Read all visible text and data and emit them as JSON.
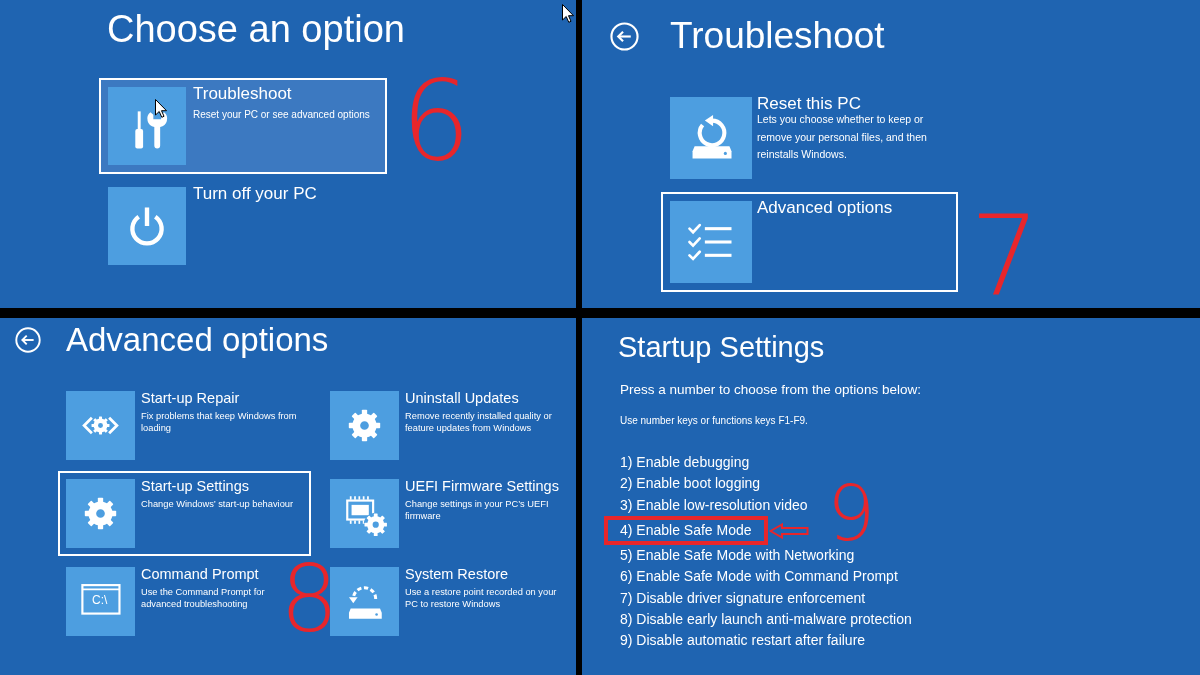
{
  "choose_option": {
    "title": "Choose an option",
    "step": "6",
    "options": [
      {
        "title": "Troubleshoot",
        "description": "Reset your PC or see advanced options",
        "selected": true,
        "hovered": true
      },
      {
        "title": "Turn off your PC",
        "selected": false,
        "hovered": false
      }
    ]
  },
  "troubleshoot": {
    "title": "Troubleshoot",
    "step": "7",
    "options": [
      {
        "title": "Reset this PC",
        "description": "Lets you choose whether to keep or remove your personal files, and then reinstalls Windows.",
        "selected": false
      },
      {
        "title": "Advanced options",
        "selected": true
      }
    ]
  },
  "advanced_options": {
    "title": "Advanced options",
    "step": "8",
    "options": [
      {
        "title": "Start-up Repair",
        "description": "Fix problems that keep Windows from loading",
        "selected": false
      },
      {
        "title": "Uninstall Updates",
        "description": "Remove recently installed quality or feature updates from Windows",
        "selected": false
      },
      {
        "title": "Start-up Settings",
        "description": "Change Windows’ start-up behaviour",
        "selected": true
      },
      {
        "title": "UEFI Firmware Settings",
        "description": "Change settings in your PC’s UEFI firmware",
        "selected": false
      },
      {
        "title": "Command Prompt",
        "description": "Use the Command Prompt for advanced troubleshooting",
        "icon_text": "C:\\",
        "selected": false
      },
      {
        "title": "System Restore",
        "description": "Use a restore point recorded on your PC to restore Windows",
        "selected": false
      }
    ]
  },
  "startup_settings": {
    "title": "Startup Settings",
    "instruction": "Press a number to choose from the options below:",
    "hint": "Use number keys or functions keys F1-F9.",
    "step": "9",
    "options": [
      {
        "label": "1) Enable debugging",
        "highlighted": false
      },
      {
        "label": "2) Enable boot logging",
        "highlighted": false
      },
      {
        "label": "3) Enable low-resolution video",
        "highlighted": false
      },
      {
        "label": "4) Enable Safe Mode",
        "highlighted": true
      },
      {
        "label": "5) Enable Safe Mode with Networking",
        "highlighted": false
      },
      {
        "label": "6) Enable Safe Mode with Command Prompt",
        "highlighted": false
      },
      {
        "label": "7) Disable driver signature enforcement",
        "highlighted": false
      },
      {
        "label": "8) Disable early launch anti-malware protection",
        "highlighted": false
      },
      {
        "label": "9) Disable automatic restart after failure",
        "highlighted": false
      }
    ]
  }
}
